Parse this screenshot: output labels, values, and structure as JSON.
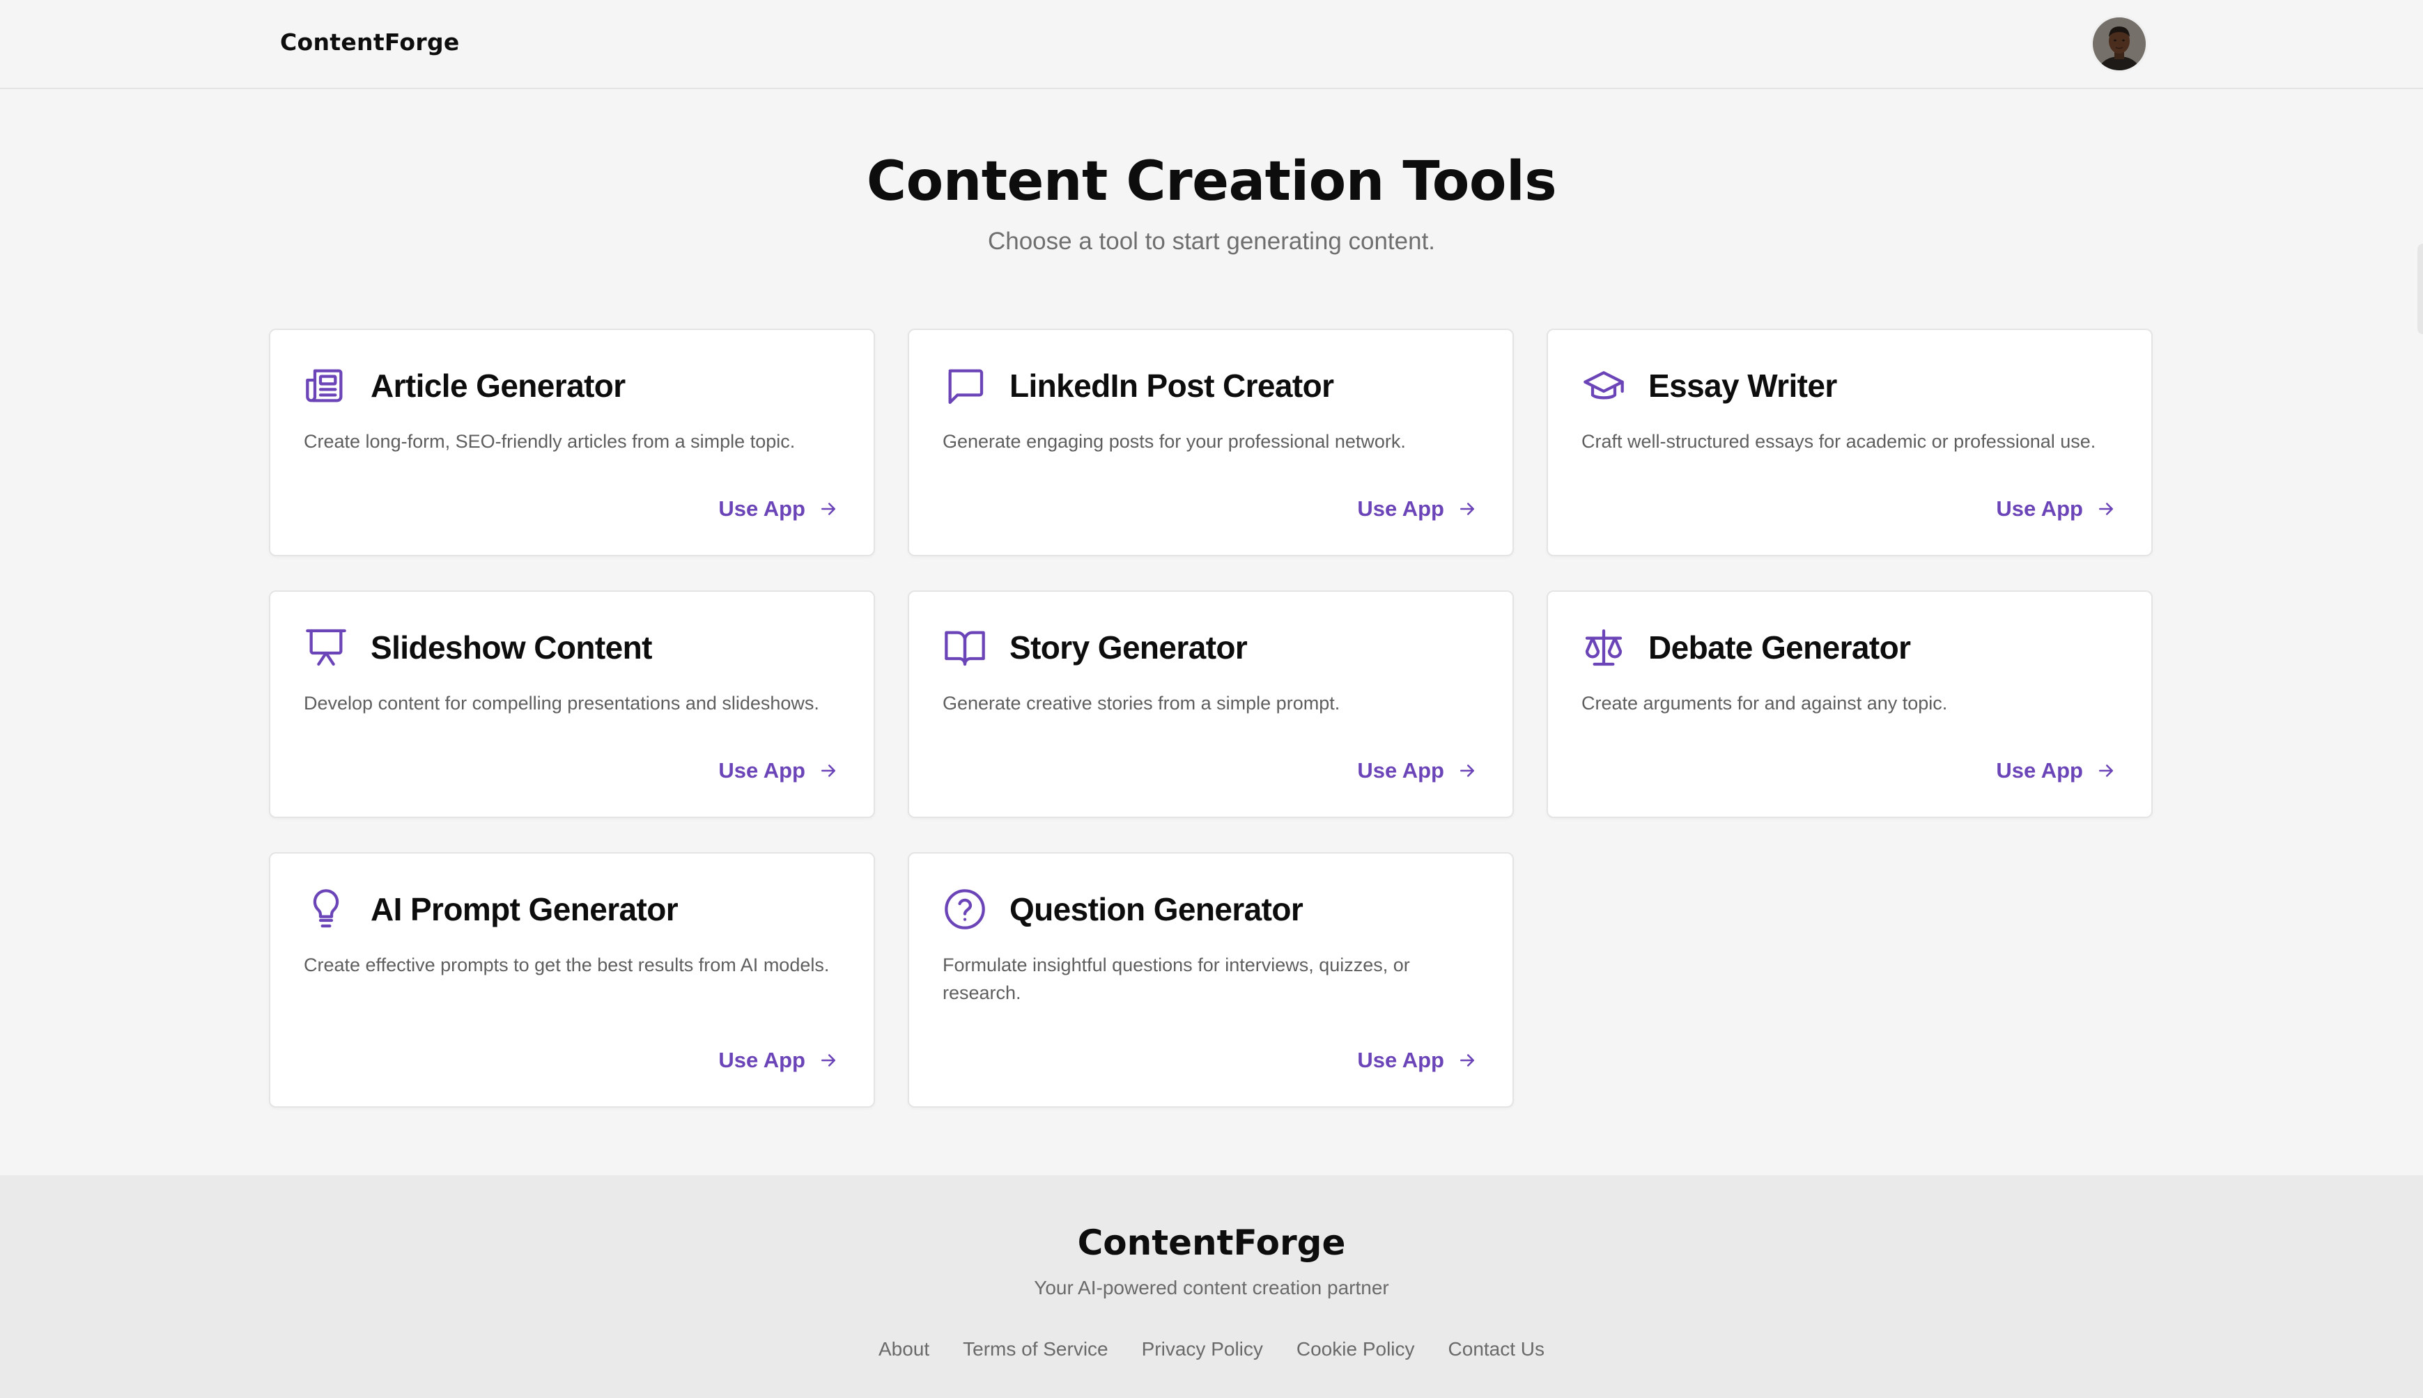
{
  "header": {
    "brand": "ContentForge",
    "avatar_alt": "User avatar"
  },
  "hero": {
    "title": "Content Creation Tools",
    "subtitle": "Choose a tool to start generating content."
  },
  "tools": [
    {
      "icon": "newspaper-icon",
      "title": "Article Generator",
      "description": "Create long-form, SEO-friendly articles from a simple topic.",
      "cta": "Use App"
    },
    {
      "icon": "chat-bubble-icon",
      "title": "LinkedIn Post Creator",
      "description": "Generate engaging posts for your professional network.",
      "cta": "Use App"
    },
    {
      "icon": "graduation-cap-icon",
      "title": "Essay Writer",
      "description": "Craft well-structured essays for academic or professional use.",
      "cta": "Use App"
    },
    {
      "icon": "presentation-icon",
      "title": "Slideshow Content",
      "description": "Develop content for compelling presentations and slideshows.",
      "cta": "Use App"
    },
    {
      "icon": "open-book-icon",
      "title": "Story Generator",
      "description": "Generate creative stories from a simple prompt.",
      "cta": "Use App"
    },
    {
      "icon": "scale-icon",
      "title": "Debate Generator",
      "description": "Create arguments for and against any topic.",
      "cta": "Use App"
    },
    {
      "icon": "lightbulb-icon",
      "title": "AI Prompt Generator",
      "description": "Create effective prompts to get the best results from AI models.",
      "cta": "Use App"
    },
    {
      "icon": "question-circle-icon",
      "title": "Question Generator",
      "description": "Formulate insightful questions for interviews, quizzes, or research.",
      "cta": "Use App"
    }
  ],
  "footer": {
    "brand": "ContentForge",
    "tagline": "Your AI-powered content creation partner",
    "links": [
      "About",
      "Terms of Service",
      "Privacy Policy",
      "Cookie Policy",
      "Contact Us"
    ]
  },
  "colors": {
    "accent": "#6b45b8",
    "background": "#f5f5f5",
    "footer_background": "#eaeaea"
  }
}
